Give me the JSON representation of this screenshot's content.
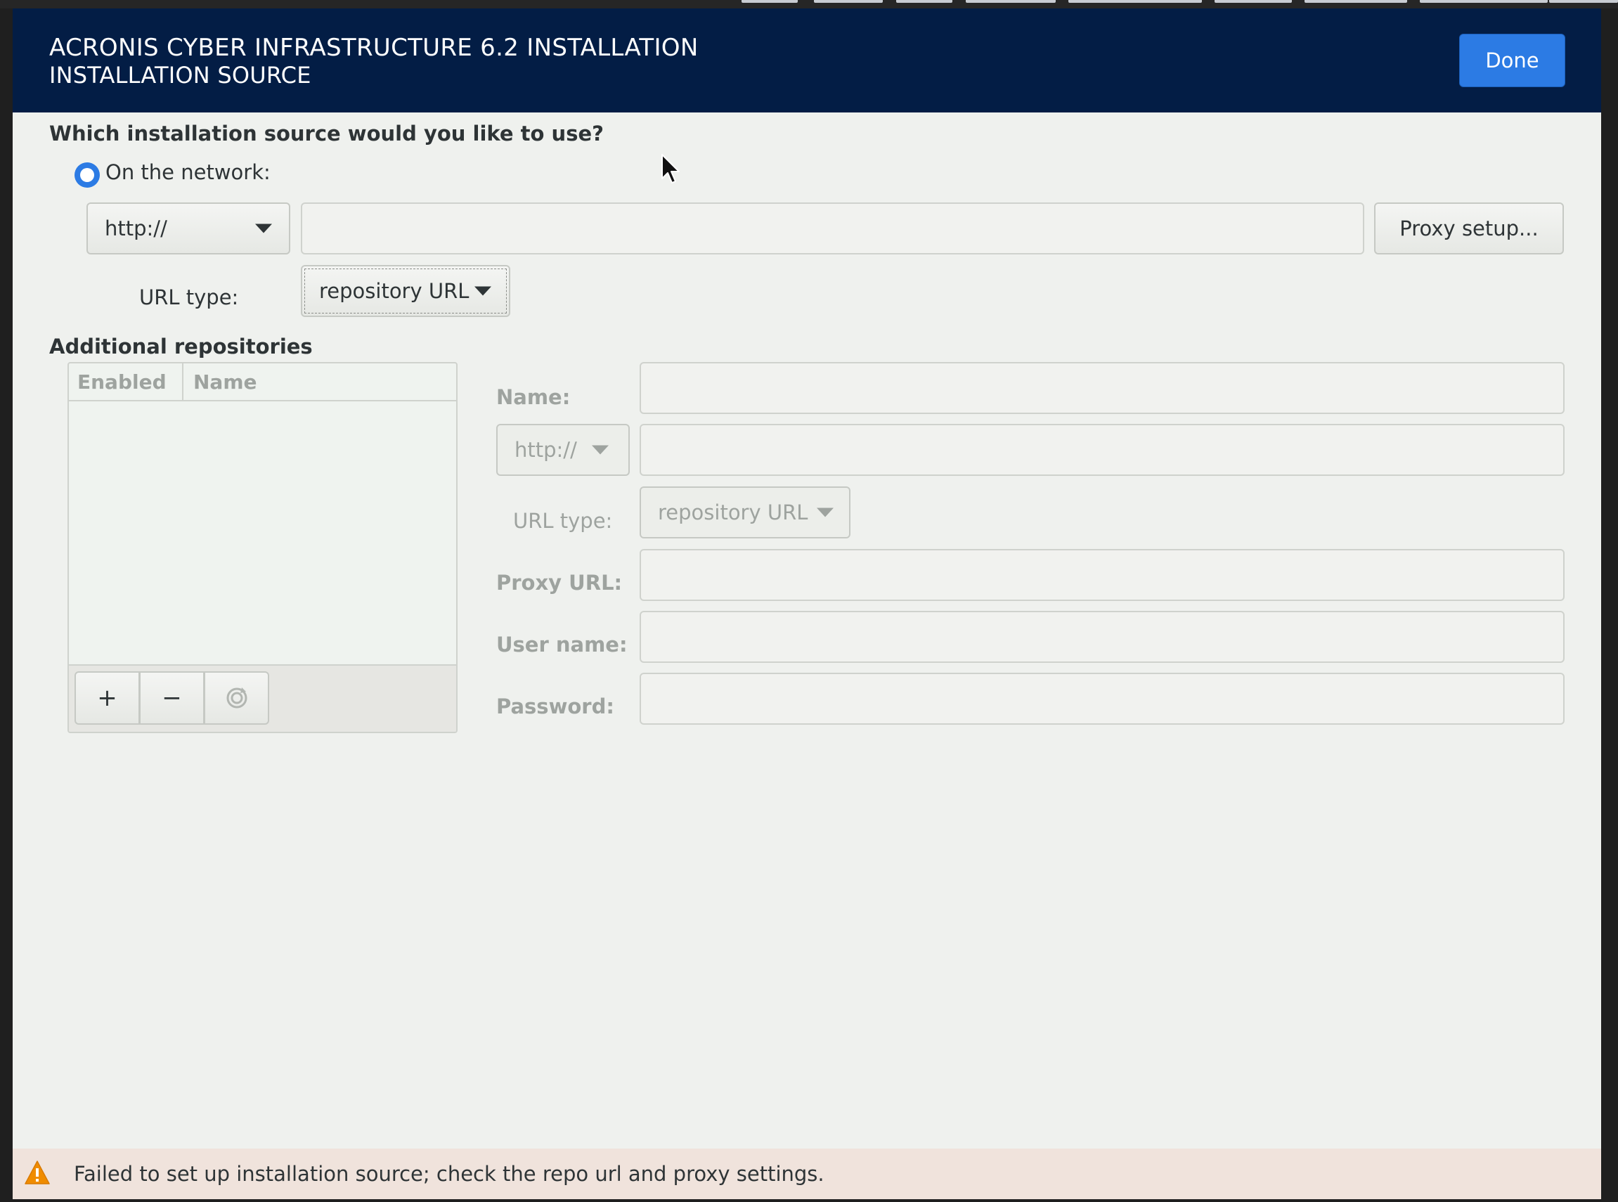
{
  "header": {
    "title": "ACRONIS CYBER INFRASTRUCTURE 6.2 INSTALLATION",
    "subtitle": "INSTALLATION SOURCE",
    "done_label": "Done"
  },
  "source": {
    "question": "Which installation source would you like to use?",
    "network_label": "On the network:",
    "protocol": "http://",
    "url_value": "",
    "proxy_button": "Proxy setup...",
    "url_type_label": "URL type:",
    "url_type_value": "repository URL"
  },
  "additional": {
    "heading": "Additional repositories",
    "columns": [
      "Enabled",
      "Name"
    ],
    "rows": [],
    "add_label": "+",
    "remove_label": "−",
    "refresh_icon": "refresh-icon",
    "form": {
      "name_label": "Name:",
      "protocol": "http://",
      "url_type_label": "URL type:",
      "url_type_value": "repository URL",
      "proxy_url_label": "Proxy URL:",
      "username_label": "User name:",
      "password_label": "Password:"
    }
  },
  "status": {
    "icon": "warning-icon",
    "message": "Failed to set up installation source; check the repo url and proxy settings."
  },
  "colors": {
    "header_bg": "#031d45",
    "accent": "#2c7be4",
    "status_bg": "#f0e3dc",
    "warning": "#f08c00"
  }
}
